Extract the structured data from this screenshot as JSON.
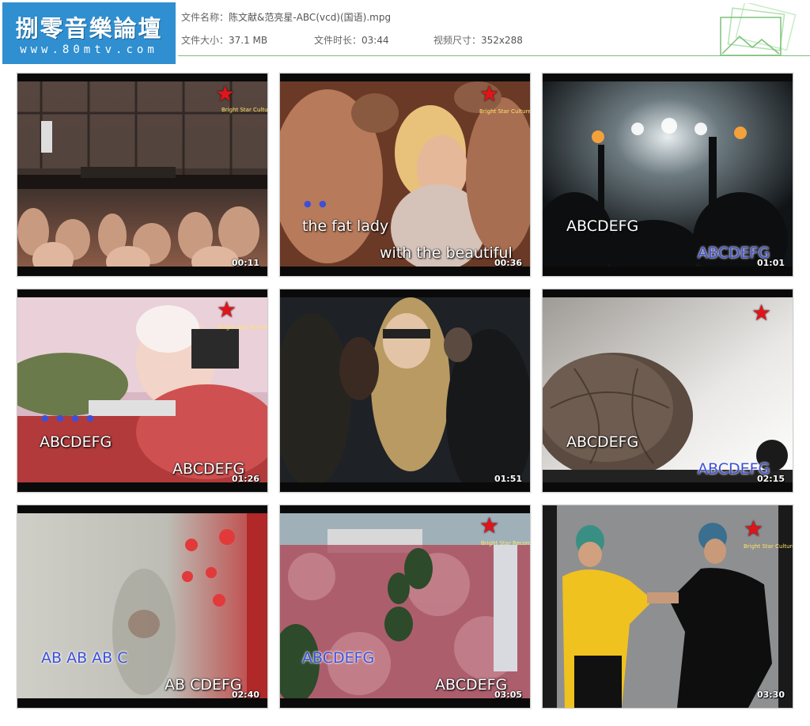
{
  "header": {
    "logo_title": "捌零音樂論壇",
    "logo_url": "www.80mtv.com",
    "file_name_label": "文件名称：",
    "file_name": "陈文献&范亮星-ABC(vcd)(国语).mpg",
    "file_size_label": "文件大小：",
    "file_size": "37.1 MB",
    "duration_label": "文件时长：",
    "duration": "03:44",
    "dimensions_label": "视频尺寸：",
    "dimensions": "352x288"
  },
  "colors": {
    "logo_bg": "#2f8fd0",
    "header_rule": "#7cc07a",
    "caption_blue": "#3d4fd8",
    "logo_star": "#e0141a"
  },
  "thumbnails": [
    {
      "time": "00:11",
      "captions": []
    },
    {
      "time": "00:36",
      "captions": [
        "the fat lady",
        "with the beautiful"
      ]
    },
    {
      "time": "01:01",
      "captions": [
        "ABCDEFG",
        "ABCDEFG"
      ]
    },
    {
      "time": "01:26",
      "captions": [
        "ABCDEFG",
        "ABCDEFG"
      ]
    },
    {
      "time": "01:51",
      "captions": []
    },
    {
      "time": "02:15",
      "captions": [
        "ABCDEFG",
        "ABCDEFG"
      ]
    },
    {
      "time": "02:40",
      "captions": [
        "AB AB  AB C",
        "AB CDEFG"
      ]
    },
    {
      "time": "03:05",
      "captions": [
        "ABCDEFG",
        "ABCDEFG"
      ]
    },
    {
      "time": "03:30",
      "captions": []
    }
  ]
}
